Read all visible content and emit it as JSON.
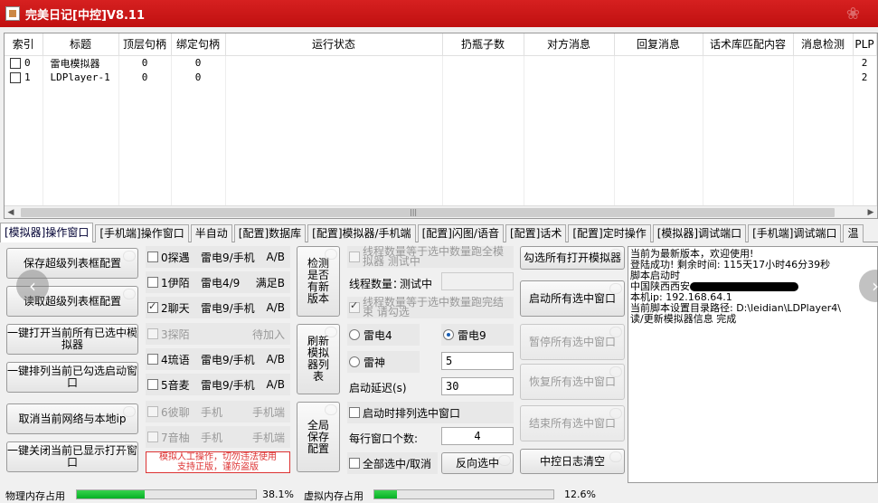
{
  "window": {
    "title": "完美日记[中控]V8.11"
  },
  "grid": {
    "headers": [
      "索引",
      "标题",
      "顶层句柄",
      "绑定句柄",
      "运行状态",
      "扔瓶子数",
      "对方消息",
      "回复消息",
      "话术库匹配内容",
      "消息检测",
      "PLP"
    ],
    "rows": [
      {
        "index": "0",
        "title": "雷电模拟器",
        "top": "0",
        "bind": "0",
        "plp": "2"
      },
      {
        "index": "1",
        "title": "LDPlayer-1",
        "top": "0",
        "bind": "0",
        "plp": "2"
      }
    ]
  },
  "tabs": [
    "[模拟器]操作窗口",
    "[手机端]操作窗口",
    "半自动",
    "[配置]数据库",
    "[配置]模拟器/手机端",
    "[配置]闪图/语音",
    "[配置]话术",
    "[配置]定时操作",
    "[模拟器]调试端口",
    "[手机端]调试端口",
    "温"
  ],
  "left_buttons": [
    "保存超级列表框配置",
    "读取超级列表框配置",
    "一键打开当前所有已选中模拟器",
    "一键排列当前已勾选启动窗口",
    "取消当前网络与本地ip",
    "一键关闭当前已显示打开窗口"
  ],
  "options": [
    {
      "label": "0探遇",
      "device": "雷电9/手机",
      "mode": "A/B",
      "checked": false,
      "disabled": false
    },
    {
      "label": "1伊陌",
      "device": "雷电4/9",
      "mode": "满足B",
      "checked": false,
      "disabled": false
    },
    {
      "label": "2聊天",
      "device": "雷电9/手机",
      "mode": "A/B",
      "checked": true,
      "disabled": false
    },
    {
      "label": "3探陌",
      "device": "",
      "mode": "待加入",
      "checked": false,
      "disabled": true
    },
    {
      "label": "4琉语",
      "device": "雷电9/手机",
      "mode": "A/B",
      "checked": false,
      "disabled": false
    },
    {
      "label": "5音麦",
      "device": "雷电9/手机",
      "mode": "A/B",
      "checked": false,
      "disabled": false
    },
    {
      "label": "6彼聊",
      "device": "手机",
      "mode": "手机端",
      "checked": false,
      "disabled": true
    },
    {
      "label": "7音柚",
      "device": "手机",
      "mode": "手机端",
      "checked": false,
      "disabled": true
    }
  ],
  "warning": "模拟人工操作，切勿违法使用\n支持正版，谨防盗版",
  "mid_buttons": [
    "检测是否有新版本",
    "刷新模拟器列表",
    "全局保存配置"
  ],
  "config": {
    "thread_check_all": "线程数量等于选中数量跑全模拟器     测试中",
    "thread_label": "线程数量：",
    "thread_value": "测试中",
    "thread_check_done": "线程数量等于选中数量跑完结束     请勾选",
    "radio_ld4": "雷电4",
    "radio_ld9": "雷电9",
    "radio_shen": "雷神",
    "shen_value": "5",
    "delay_label": "启动延迟(s)",
    "delay_value": "30",
    "arrange_check": "启动时排列选中窗口",
    "per_row_label": "每行窗口个数:",
    "per_row_value": "4",
    "select_all": "全部选中/取消",
    "invert_button": "反向选中"
  },
  "right_buttons": [
    {
      "label": "勾选所有打开模拟器",
      "disabled": false
    },
    {
      "label": "启动所有选中窗口",
      "disabled": false
    },
    {
      "label": "暂停所有选中窗口",
      "disabled": true
    },
    {
      "label": "恢复所有选中窗口",
      "disabled": true
    },
    {
      "label": "结束所有选中窗口",
      "disabled": true
    },
    {
      "label": "中控日志清空",
      "disabled": false
    }
  ],
  "log": {
    "line1": "当前为最新版本，欢迎使用!",
    "line2": "登陆成功! 剩余时间: 115天17小时46分39秒",
    "line3": "脚本启动时",
    "line4": "中国陕西西安",
    "line5": "本机ip: 192.168.64.1",
    "line6": "当前脚本设置目录路径: D:\\leidian\\LDPlayer4\\",
    "line7": "读/更新模拟器信息 完成"
  },
  "status": {
    "physical_label": "物理内存占用",
    "physical_pct": "38.1%",
    "physical_value": 38.1,
    "virtual_label": "虚拟内存占用",
    "virtual_pct": "12.6%",
    "virtual_value": 12.6
  }
}
